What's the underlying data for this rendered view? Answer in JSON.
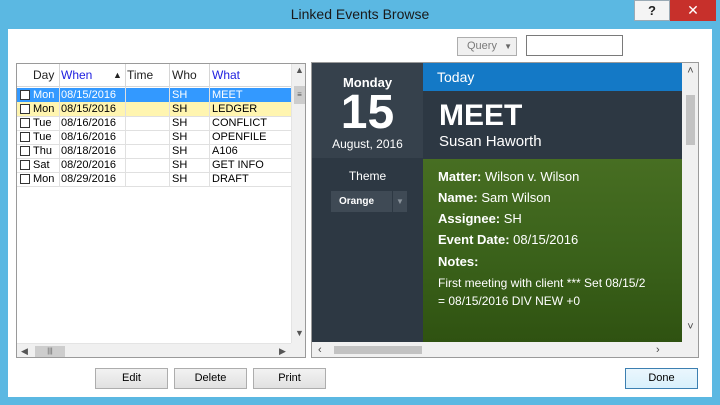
{
  "window": {
    "title": "Linked Events Browse",
    "help_label": "?",
    "close_label": "✕"
  },
  "query": {
    "button_label": "Query",
    "input_value": ""
  },
  "grid": {
    "columns": [
      {
        "label": "Day"
      },
      {
        "label": "When"
      },
      {
        "label": "Time"
      },
      {
        "label": "Who"
      },
      {
        "label": "What"
      }
    ],
    "sort_indicator": "▲",
    "rows": [
      {
        "day": "Mon",
        "when": "08/15/2016",
        "time": "",
        "who": "SH",
        "what": "MEET",
        "state": "selected"
      },
      {
        "day": "Mon",
        "when": "08/15/2016",
        "time": "",
        "who": "SH",
        "what": "LEDGER",
        "state": "hilite"
      },
      {
        "day": "Tue",
        "when": "08/16/2016",
        "time": "",
        "who": "SH",
        "what": "CONFLICT",
        "state": ""
      },
      {
        "day": "Tue",
        "when": "08/16/2016",
        "time": "",
        "who": "SH",
        "what": "OPENFILE",
        "state": ""
      },
      {
        "day": "Thu",
        "when": "08/18/2016",
        "time": "",
        "who": "SH",
        "what": "A106",
        "state": ""
      },
      {
        "day": "Sat",
        "when": "08/20/2016",
        "time": "",
        "who": "SH",
        "what": "GET INFO",
        "state": ""
      },
      {
        "day": "Mon",
        "when": "08/29/2016",
        "time": "",
        "who": "SH",
        "what": "DRAFT",
        "state": ""
      }
    ]
  },
  "calendar": {
    "weekday": "Monday",
    "day_number": "15",
    "month_year": "August, 2016",
    "theme_label": "Theme",
    "theme_value": "Orange"
  },
  "event": {
    "header": "Today",
    "type": "MEET",
    "person": "Susan Haworth",
    "fields": {
      "matter_label": "Matter:",
      "matter_value": "Wilson v. Wilson",
      "name_label": "Name:",
      "name_value": "Sam Wilson",
      "assignee_label": "Assignee:",
      "assignee_value": "SH",
      "date_label": "Event Date:",
      "date_value": "08/15/2016",
      "notes_label": "Notes:"
    },
    "notes_line1": "First meeting with client *** Set 08/15/2",
    "notes_line2": "= 08/15/2016 DIV NEW +0"
  },
  "buttons": {
    "edit": "Edit",
    "delete": "Delete",
    "print": "Print",
    "done": "Done"
  },
  "colors": {
    "selected_row": "#3399ff",
    "highlight_row": "#fff5b0",
    "today_bar": "#1479c6",
    "event_body": "#476e22",
    "close_button": "#c7302b"
  }
}
